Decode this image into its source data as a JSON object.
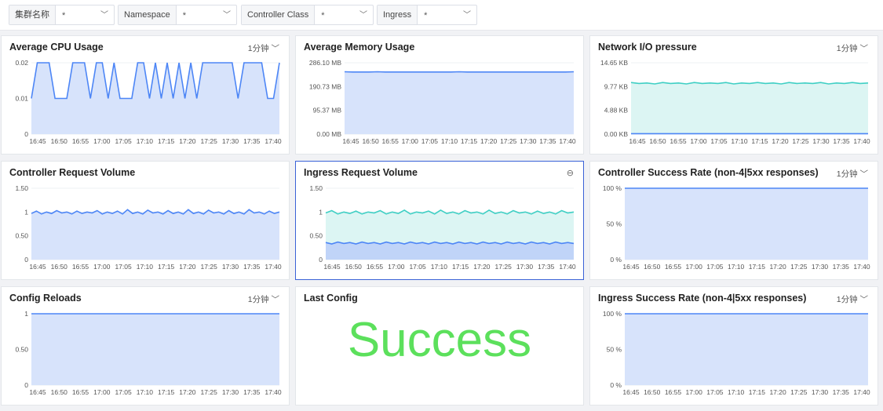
{
  "filters": [
    {
      "label": "集群名称",
      "value": "*"
    },
    {
      "label": "Namespace",
      "value": "*"
    },
    {
      "label": "Controller Class",
      "value": "*"
    },
    {
      "label": "Ingress",
      "value": "*"
    }
  ],
  "icons": {
    "chevron": "chevron-down-icon",
    "zoom": "zoom-icon"
  },
  "colors": {
    "blue_line": "#4d86f6",
    "blue_fill": "#d7e3fb",
    "teal_line": "#3fcfc4",
    "teal_fill": "#dcf5f3",
    "success": "#5ce05c",
    "selected_border": "#3a62d7"
  },
  "panels": [
    {
      "id": "cpu",
      "title": "Average CPU Usage",
      "interval": "1分钟"
    },
    {
      "id": "mem",
      "title": "Average Memory Usage",
      "interval": ""
    },
    {
      "id": "net",
      "title": "Network I/O pressure",
      "interval": "1分钟"
    },
    {
      "id": "creq",
      "title": "Controller Request Volume",
      "interval": ""
    },
    {
      "id": "ireq",
      "title": "Ingress Request Volume",
      "interval": ""
    },
    {
      "id": "csr",
      "title": "Controller Success Rate (non-4|5xx responses)",
      "interval": "1分钟"
    },
    {
      "id": "reload",
      "title": "Config Reloads",
      "interval": "1分钟"
    },
    {
      "id": "last",
      "title": "Last Config",
      "interval": "",
      "big_text": "Success"
    },
    {
      "id": "isr",
      "title": "Ingress Success Rate (non-4|5xx responses)",
      "interval": "1分钟"
    }
  ],
  "chart_data": [
    {
      "id": "cpu",
      "type": "area",
      "x_ticks": [
        "16:45",
        "16:50",
        "16:55",
        "17:00",
        "17:05",
        "17:10",
        "17:15",
        "17:20",
        "17:25",
        "17:30",
        "17:35",
        "17:40"
      ],
      "y_ticks": [
        "0",
        "0.01",
        "0.02"
      ],
      "ylim": [
        0,
        0.02
      ],
      "series": [
        {
          "values": [
            0.01,
            0.02,
            0.02,
            0.02,
            0.01,
            0.01,
            0.01,
            0.02,
            0.02,
            0.02,
            0.01,
            0.02,
            0.02,
            0.01,
            0.02,
            0.01,
            0.01,
            0.01,
            0.02,
            0.02,
            0.01,
            0.02,
            0.01,
            0.02,
            0.01,
            0.02,
            0.01,
            0.02,
            0.01,
            0.02,
            0.02,
            0.02,
            0.02,
            0.02,
            0.02,
            0.01,
            0.02,
            0.02,
            0.02,
            0.02,
            0.01,
            0.01,
            0.02
          ]
        }
      ]
    },
    {
      "id": "mem",
      "type": "area",
      "x_ticks": [
        "16:45",
        "16:50",
        "16:55",
        "17:00",
        "17:05",
        "17:10",
        "17:15",
        "17:20",
        "17:25",
        "17:30",
        "17:35",
        "17:40"
      ],
      "y_ticks": [
        "0.00 MB",
        "95.37 MB",
        "190.73 MB",
        "286.10 MB"
      ],
      "ylim": [
        0,
        286.1
      ],
      "series": [
        {
          "values": [
            250,
            249,
            249,
            249,
            250,
            249,
            249,
            249,
            249,
            249,
            249,
            249,
            249,
            249,
            250,
            249,
            249,
            249,
            249,
            249,
            249,
            249,
            249,
            249,
            249,
            249,
            249,
            249,
            250
          ]
        }
      ]
    },
    {
      "id": "net",
      "type": "area",
      "x_ticks": [
        "16:45",
        "16:50",
        "16:55",
        "17:00",
        "17:05",
        "17:10",
        "17:15",
        "17:20",
        "17:25",
        "17:30",
        "17:35",
        "17:40"
      ],
      "y_ticks": [
        "0.00 KB",
        "4.88 KB",
        "9.77 KB",
        "14.65 KB"
      ],
      "ylim": [
        0,
        14.65
      ],
      "series": [
        {
          "values": [
            10.6,
            10.4,
            10.5,
            10.3,
            10.6,
            10.4,
            10.5,
            10.3,
            10.6,
            10.4,
            10.5,
            10.4,
            10.6,
            10.3,
            10.5,
            10.4,
            10.6,
            10.4,
            10.5,
            10.3,
            10.6,
            10.4,
            10.5,
            10.4,
            10.6,
            10.3,
            10.5,
            10.4,
            10.6,
            10.4,
            10.5
          ]
        },
        {
          "values": [
            0.1,
            0.1,
            0.1,
            0.1,
            0.1,
            0.1,
            0.1,
            0.1,
            0.1,
            0.1,
            0.1,
            0.1,
            0.1,
            0.1,
            0.1,
            0.1,
            0.1,
            0.1,
            0.1,
            0.1,
            0.1,
            0.1,
            0.1,
            0.1,
            0.1,
            0.1,
            0.1,
            0.1,
            0.1,
            0.1,
            0.1
          ]
        }
      ]
    },
    {
      "id": "creq",
      "type": "area",
      "x_ticks": [
        "16:45",
        "16:50",
        "16:55",
        "17:00",
        "17:05",
        "17:10",
        "17:15",
        "17:20",
        "17:25",
        "17:30",
        "17:35",
        "17:40"
      ],
      "y_ticks": [
        "0",
        "0.50",
        "1",
        "1.50"
      ],
      "ylim": [
        0,
        1.5
      ],
      "series": [
        {
          "values": [
            0.97,
            1.02,
            0.96,
            1.0,
            0.97,
            1.03,
            0.98,
            1.0,
            0.96,
            1.02,
            0.97,
            1.0,
            0.98,
            1.03,
            0.96,
            1.0,
            0.97,
            1.02,
            0.96,
            1.05,
            0.97,
            1.0,
            0.96,
            1.04,
            0.98,
            1.0,
            0.96,
            1.03,
            0.97,
            1.0,
            0.96,
            1.05,
            0.97,
            1.0,
            0.96,
            1.04,
            0.98,
            1.0,
            0.96,
            1.03,
            0.97,
            1.0,
            0.96,
            1.05,
            0.98,
            1.0,
            0.96,
            1.02,
            0.97,
            1.0
          ]
        }
      ]
    },
    {
      "id": "ireq",
      "type": "area",
      "x_ticks": [
        "16:45",
        "16:50",
        "16:55",
        "17:00",
        "17:05",
        "17:10",
        "17:15",
        "17:20",
        "17:25",
        "17:30",
        "17:35",
        "17:40"
      ],
      "y_ticks": [
        "0",
        "0.50",
        "1",
        "1.50"
      ],
      "ylim": [
        0,
        1.5
      ],
      "series": [
        {
          "values": [
            0.98,
            1.03,
            0.96,
            1.0,
            0.97,
            1.02,
            0.96,
            1.0,
            0.98,
            1.03,
            0.96,
            1.0,
            0.97,
            1.04,
            0.96,
            1.0,
            0.98,
            1.02,
            0.96,
            1.04,
            0.97,
            1.0,
            0.96,
            1.03,
            0.98,
            1.0,
            0.96,
            1.04,
            0.97,
            1.0,
            0.96,
            1.03,
            0.98,
            1.0,
            0.96,
            1.02,
            0.97,
            1.0,
            0.96,
            1.03,
            0.98,
            1.0
          ]
        },
        {
          "values": [
            0.36,
            0.33,
            0.37,
            0.34,
            0.36,
            0.33,
            0.37,
            0.34,
            0.36,
            0.33,
            0.37,
            0.34,
            0.36,
            0.33,
            0.37,
            0.34,
            0.36,
            0.33,
            0.37,
            0.34,
            0.36,
            0.33,
            0.37,
            0.34,
            0.36,
            0.33,
            0.37,
            0.34,
            0.36,
            0.33,
            0.37,
            0.34,
            0.36,
            0.33,
            0.37,
            0.34,
            0.36,
            0.33,
            0.37,
            0.34,
            0.36,
            0.34
          ]
        }
      ]
    },
    {
      "id": "csr",
      "type": "area",
      "x_ticks": [
        "16:45",
        "16:50",
        "16:55",
        "17:00",
        "17:05",
        "17:10",
        "17:15",
        "17:20",
        "17:25",
        "17:30",
        "17:35",
        "17:40"
      ],
      "y_ticks": [
        "0 %",
        "50 %",
        "100 %"
      ],
      "ylim": [
        0,
        100
      ],
      "series": [
        {
          "values": [
            100,
            100,
            100,
            100,
            100,
            100,
            100,
            100,
            100,
            100,
            100,
            100
          ]
        }
      ]
    },
    {
      "id": "reload",
      "type": "area",
      "x_ticks": [
        "16:45",
        "16:50",
        "16:55",
        "17:00",
        "17:05",
        "17:10",
        "17:15",
        "17:20",
        "17:25",
        "17:30",
        "17:35",
        "17:40"
      ],
      "y_ticks": [
        "0",
        "0.50",
        "1"
      ],
      "ylim": [
        0,
        1
      ],
      "series": [
        {
          "values": [
            1,
            1,
            1,
            1,
            1,
            1,
            1,
            1,
            1,
            1,
            1,
            1
          ]
        }
      ]
    },
    {
      "id": "isr",
      "type": "area",
      "x_ticks": [
        "16:45",
        "16:50",
        "16:55",
        "17:00",
        "17:05",
        "17:10",
        "17:15",
        "17:20",
        "17:25",
        "17:30",
        "17:35",
        "17:40"
      ],
      "y_ticks": [
        "0 %",
        "50 %",
        "100 %"
      ],
      "ylim": [
        0,
        100
      ],
      "series": [
        {
          "values": [
            100,
            100,
            100,
            100,
            100,
            100,
            100,
            100,
            100,
            100,
            100,
            100
          ]
        }
      ]
    }
  ]
}
